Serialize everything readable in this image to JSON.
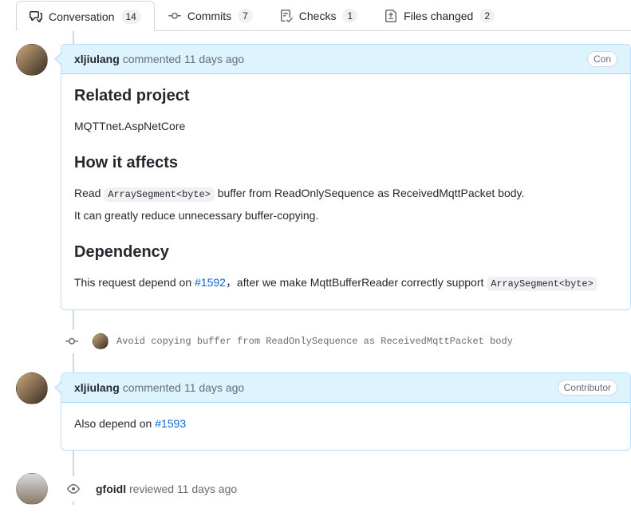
{
  "tabs": {
    "conversation": {
      "label": "Conversation",
      "count": "14"
    },
    "commits": {
      "label": "Commits",
      "count": "7"
    },
    "checks": {
      "label": "Checks",
      "count": "1"
    },
    "files": {
      "label": "Files changed",
      "count": "2"
    }
  },
  "comment1": {
    "author": "xljiulang",
    "verb": "commented",
    "time": "11 days ago",
    "badge": "Con",
    "h_related": "Related project",
    "related_text": "MQTTnet.AspNetCore",
    "h_affects": "How it affects",
    "affects_pre": "Read ",
    "affects_code": "ArraySegment<byte>",
    "affects_post": " buffer from ReadOnlySequence as ReceivedMqttPacket body.",
    "affects_line2": "It can greatly reduce unnecessary buffer-copying.",
    "h_dep": "Dependency",
    "dep_pre": "This request depend on ",
    "dep_link": "#1592",
    "dep_mid": "，after we make MqttBufferReader correctly support ",
    "dep_code": "ArraySegment<byte>"
  },
  "commit": {
    "msg": "Avoid copying buffer from ReadOnlySequence as ReceivedMqttPacket body"
  },
  "comment2": {
    "author": "xljiulang",
    "verb": "commented",
    "time": "11 days ago",
    "badge": "Contributor",
    "body_pre": "Also depend on ",
    "body_link": "#1593"
  },
  "review": {
    "author": "gfoidl",
    "verb": "reviewed",
    "time": "11 days ago"
  }
}
